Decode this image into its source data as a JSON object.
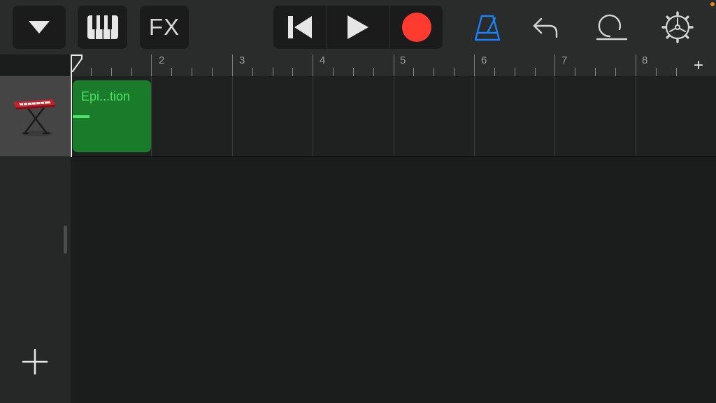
{
  "toolbar": {
    "view_menu_icon": "triangle-down-icon",
    "instrument_icon": "piano-keys-icon",
    "fx_label": "FX",
    "transport": {
      "rewind_icon": "go-to-beginning-icon",
      "play_icon": "play-icon",
      "record_icon": "record-icon"
    },
    "metronome_icon": "metronome-icon",
    "undo_icon": "undo-icon",
    "loop_icon": "loop-browser-icon",
    "settings_icon": "gear-icon",
    "accent_color": "#1a82fb",
    "record_color": "#ff3b30",
    "status_dot_color": "#e38a1c"
  },
  "ruler": {
    "bar_numbers": [
      "2",
      "3",
      "4",
      "5",
      "6",
      "7",
      "8"
    ],
    "add_section_label": "+"
  },
  "tracks": [
    {
      "instrument_icon": "keyboard-instrument-icon",
      "regions": [
        {
          "name": "Epi...tion",
          "color": "#1a7c2b",
          "text_color": "#51e06b"
        }
      ]
    }
  ],
  "sidebar": {
    "add_track_icon": "plus-icon"
  }
}
